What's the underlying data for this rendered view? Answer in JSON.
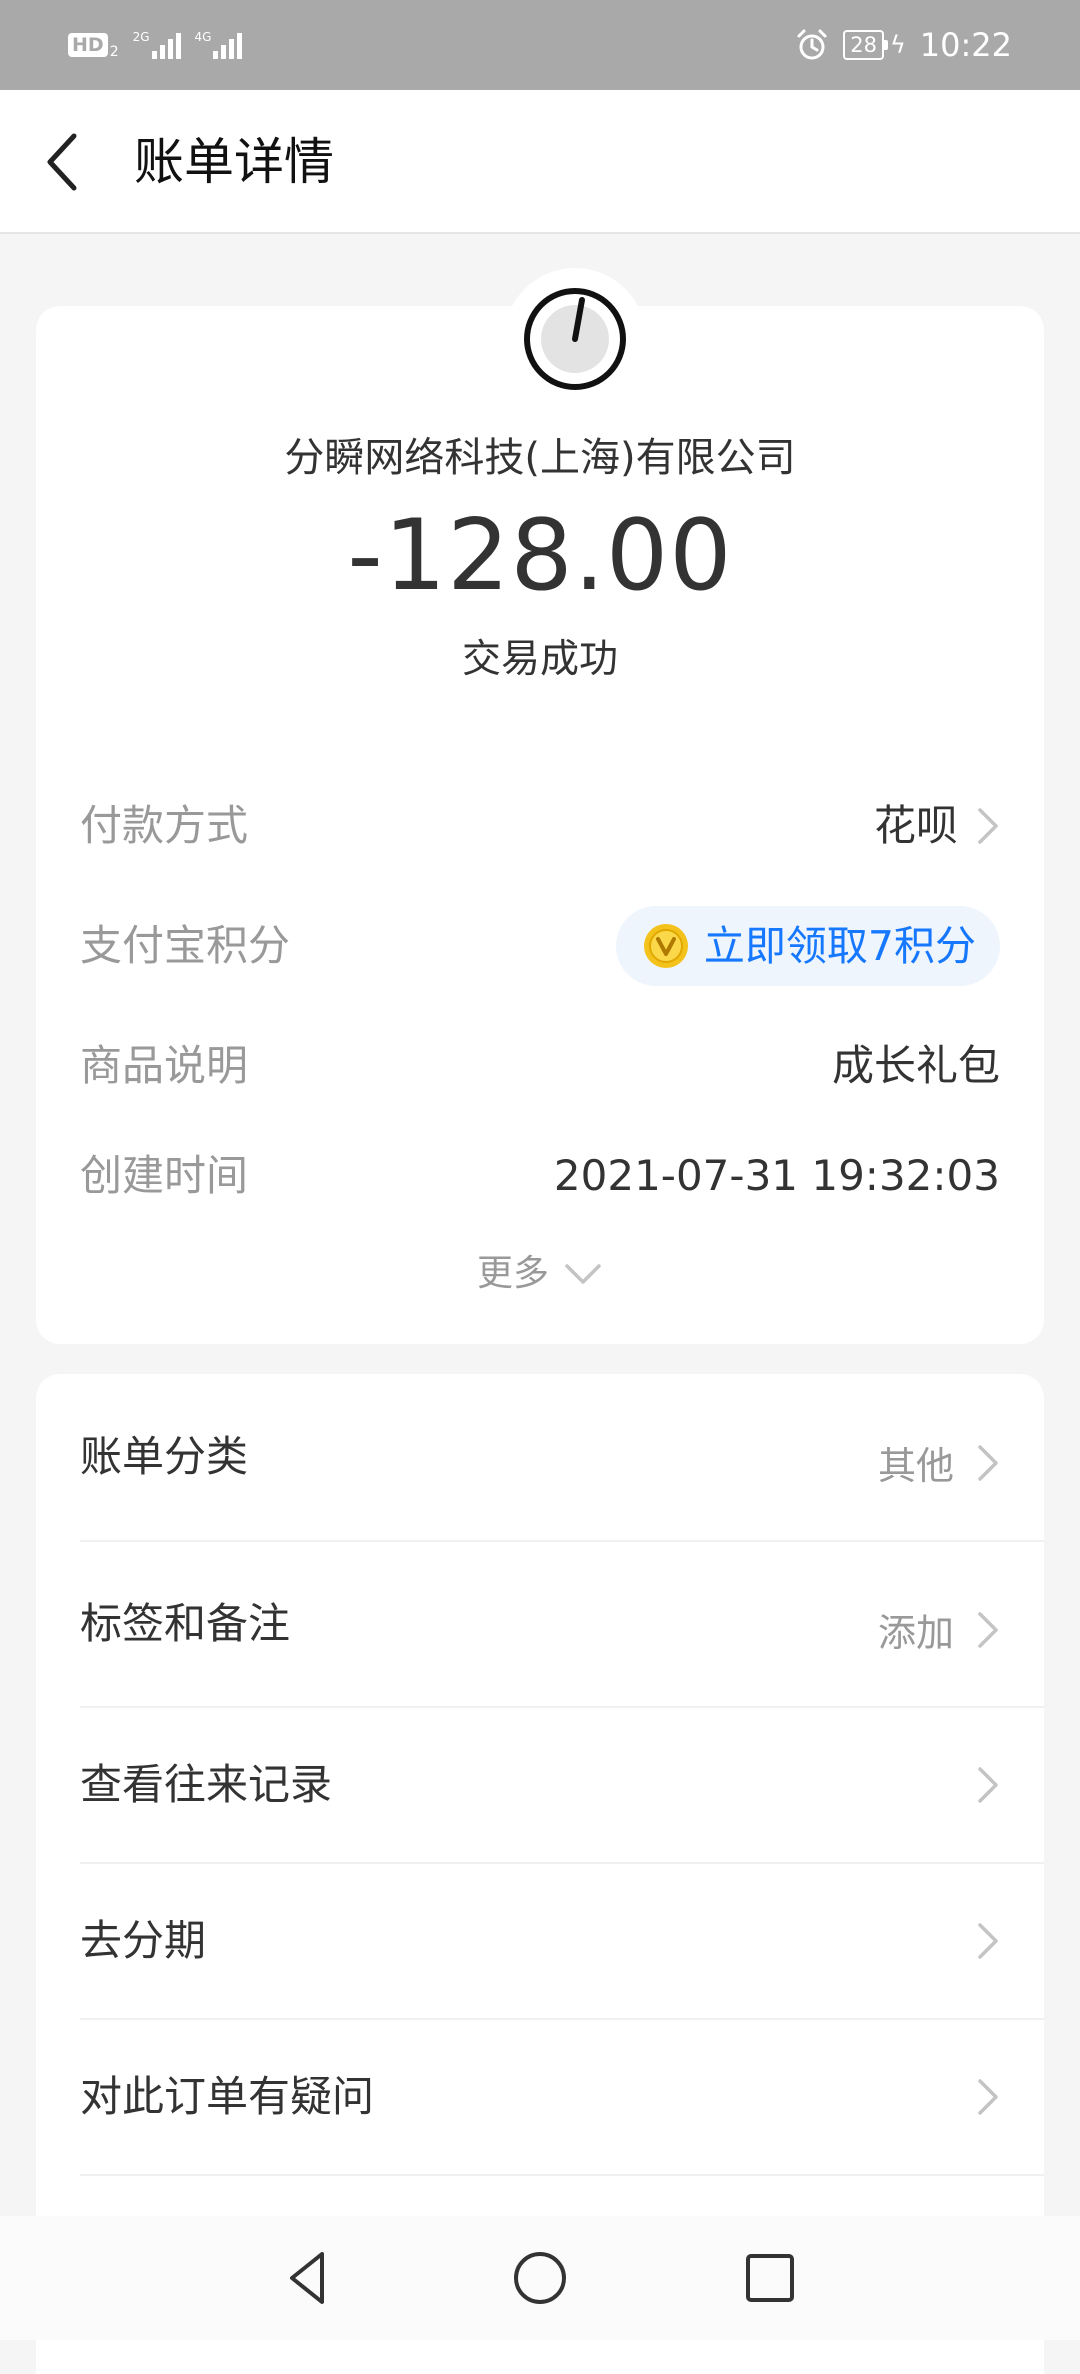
{
  "status_bar": {
    "hd_label": "HD",
    "hd_sub": "2",
    "sim1_label": "2G",
    "sim2_label": "4G",
    "battery": "28",
    "time": "10:22"
  },
  "header": {
    "title": "账单详情"
  },
  "bill": {
    "merchant": "分瞬网络科技(上海)有限公司",
    "amount": "-128.00",
    "status": "交易成功",
    "rows": [
      {
        "label": "付款方式",
        "value": "花呗"
      },
      {
        "label": "支付宝积分",
        "value": "立即领取7积分"
      },
      {
        "label": "商品说明",
        "value": "成长礼包"
      },
      {
        "label": "创建时间",
        "value": "2021-07-31 19:32:03"
      }
    ],
    "more": "更多"
  },
  "actions": [
    {
      "label": "账单分类",
      "value": "其他"
    },
    {
      "label": "标签和备注",
      "value": "添加"
    },
    {
      "label": "查看往来记录",
      "value": ""
    },
    {
      "label": "去分期",
      "value": ""
    },
    {
      "label": "对此订单有疑问",
      "value": ""
    }
  ],
  "colors": {
    "accent_blue": "#1677ff",
    "points_bg": "#eef5fc",
    "coin_gold": "#f3c21b",
    "status_bar_bg": "#a9a9a9"
  },
  "icons": {
    "back": "chevron-left-icon",
    "alarm": "alarm-icon",
    "merchant_logo": "power-dial-icon",
    "coin": "coin-v-icon",
    "chevron": "chevron-right-icon",
    "more": "chevron-down-icon",
    "nav_back": "triangle-back-icon",
    "nav_home": "circle-home-icon",
    "nav_recent": "square-recent-icon"
  }
}
